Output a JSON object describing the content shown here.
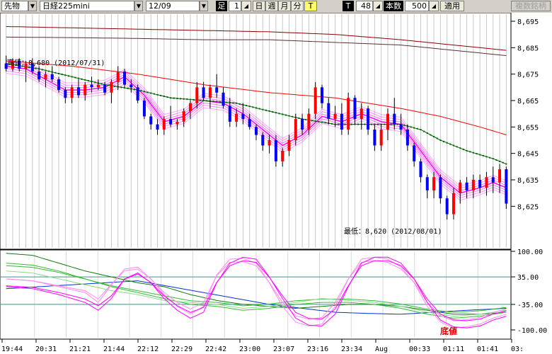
{
  "toolbar": {
    "market_type": "先物",
    "instrument": "日経225mini",
    "contract": "12/09",
    "foot_label": "足",
    "foot_value": "1",
    "period_day": "日",
    "period_week": "週",
    "period_month": "月",
    "period_year": "分",
    "t_label": "T",
    "t_dark_label": "T",
    "t_value": "48",
    "count_label": "本数",
    "count_value": "500",
    "apply_label": "適用",
    "multi_label": "複数銘柄"
  },
  "colors": {
    "up_candle": "#ff0000",
    "down_candle": "#0000ff",
    "ma_dark_red": "#8b0000",
    "ma_red": "#ff0000",
    "ma_brown": "#5a3030",
    "ma_green": "#006400",
    "ribbon": "#ff00ff",
    "oscillator_blue": "#0033cc",
    "oscillator_green": "#00aa00",
    "oscillator_magenta": "#ff00ff",
    "reference_line": "#2e9a8f"
  },
  "chart_data": {
    "type": "candlestick",
    "price_axis": {
      "min": 8620,
      "max": 8695,
      "ticks": [
        "8,695",
        "8,685",
        "8,675",
        "8,665",
        "8,655",
        "8,645",
        "8,635",
        "8,625"
      ]
    },
    "oscillator_axis": {
      "min": -100,
      "max": 100,
      "ticks": [
        "100.00",
        "35.00",
        "-35.00",
        "-100.00"
      ]
    },
    "time_labels": [
      "19:44",
      "20:31",
      "21:21",
      "21:44",
      "22:12",
      "22:29",
      "22:42",
      "23:00",
      "23:07",
      "23:16",
      "23:34",
      "Aug",
      "00:33",
      "01:11",
      "01:41",
      "03:"
    ],
    "candles": [
      [
        8679,
        8682,
        8676,
        8677
      ],
      [
        8677,
        8681,
        8676,
        8680
      ],
      [
        8680,
        8681,
        8676,
        8677
      ],
      [
        8677,
        8680,
        8672,
        8679
      ],
      [
        8679,
        8681,
        8675,
        8676
      ],
      [
        8676,
        8678,
        8672,
        8673
      ],
      [
        8673,
        8676,
        8670,
        8675
      ],
      [
        8675,
        8678,
        8672,
        8673
      ],
      [
        8673,
        8674,
        8668,
        8669
      ],
      [
        8669,
        8670,
        8664,
        8666
      ],
      [
        8666,
        8671,
        8664,
        8670
      ],
      [
        8670,
        8673,
        8666,
        8667
      ],
      [
        8667,
        8672,
        8665,
        8671
      ],
      [
        8671,
        8674,
        8668,
        8670
      ],
      [
        8670,
        8673,
        8669,
        8671
      ],
      [
        8671,
        8672,
        8667,
        8668
      ],
      [
        8668,
        8673,
        8664,
        8672
      ],
      [
        8672,
        8678,
        8669,
        8676
      ],
      [
        8676,
        8677,
        8670,
        8671
      ],
      [
        8671,
        8673,
        8668,
        8670
      ],
      [
        8670,
        8671,
        8664,
        8665
      ],
      [
        8665,
        8666,
        8658,
        8659
      ],
      [
        8659,
        8660,
        8654,
        8656
      ],
      [
        8656,
        8658,
        8652,
        8654
      ],
      [
        8654,
        8659,
        8652,
        8658
      ],
      [
        8658,
        8663,
        8655,
        8656
      ],
      [
        8656,
        8658,
        8654,
        8657
      ],
      [
        8657,
        8662,
        8655,
        8661
      ],
      [
        8661,
        8665,
        8658,
        8664
      ],
      [
        8664,
        8672,
        8662,
        8670
      ],
      [
        8670,
        8672,
        8665,
        8666
      ],
      [
        8666,
        8671,
        8662,
        8670
      ],
      [
        8670,
        8675,
        8666,
        8668
      ],
      [
        8668,
        8670,
        8662,
        8663
      ],
      [
        8663,
        8666,
        8655,
        8657
      ],
      [
        8657,
        8662,
        8655,
        8660
      ],
      [
        8660,
        8664,
        8656,
        8658
      ],
      [
        8658,
        8660,
        8654,
        8655
      ],
      [
        8655,
        8656,
        8650,
        8652
      ],
      [
        8652,
        8653,
        8646,
        8648
      ],
      [
        8648,
        8652,
        8645,
        8650
      ],
      [
        8650,
        8652,
        8640,
        8642
      ],
      [
        8642,
        8647,
        8640,
        8646
      ],
      [
        8646,
        8652,
        8644,
        8650
      ],
      [
        8650,
        8660,
        8648,
        8658
      ],
      [
        8658,
        8660,
        8652,
        8654
      ],
      [
        8654,
        8662,
        8652,
        8660
      ],
      [
        8660,
        8672,
        8658,
        8670
      ],
      [
        8670,
        8671,
        8662,
        8664
      ],
      [
        8664,
        8666,
        8656,
        8658
      ],
      [
        8658,
        8663,
        8655,
        8660
      ],
      [
        8660,
        8664,
        8652,
        8654
      ],
      [
        8654,
        8668,
        8652,
        8666
      ],
      [
        8666,
        8667,
        8656,
        8658
      ],
      [
        8658,
        8664,
        8654,
        8662
      ],
      [
        8662,
        8663,
        8652,
        8654
      ],
      [
        8654,
        8656,
        8646,
        8648
      ],
      [
        8648,
        8656,
        8646,
        8654
      ],
      [
        8654,
        8662,
        8650,
        8660
      ],
      [
        8660,
        8666,
        8654,
        8656
      ],
      [
        8656,
        8660,
        8652,
        8654
      ],
      [
        8654,
        8656,
        8646,
        8648
      ],
      [
        8648,
        8649,
        8640,
        8642
      ],
      [
        8642,
        8643,
        8634,
        8636
      ],
      [
        8636,
        8637,
        8628,
        8631
      ],
      [
        8631,
        8638,
        8628,
        8636
      ],
      [
        8636,
        8637,
        8626,
        8628
      ],
      [
        8628,
        8629,
        8620,
        8622
      ],
      [
        8622,
        8632,
        8620,
        8630
      ],
      [
        8630,
        8635,
        8626,
        8634
      ],
      [
        8634,
        8636,
        8628,
        8631
      ],
      [
        8631,
        8637,
        8628,
        8635
      ],
      [
        8635,
        8637,
        8630,
        8632
      ],
      [
        8632,
        8638,
        8629,
        8636
      ],
      [
        8636,
        8640,
        8630,
        8634
      ],
      [
        8634,
        8641,
        8630,
        8639
      ],
      [
        8639,
        8640,
        8624,
        8626
      ]
    ],
    "ma_dark_red": [
      [
        0,
        8693
      ],
      [
        10,
        8692.5
      ],
      [
        20,
        8692
      ],
      [
        30,
        8691.5
      ],
      [
        40,
        8691
      ],
      [
        50,
        8690
      ],
      [
        60,
        8688
      ],
      [
        76,
        8684
      ]
    ],
    "ma_brown": [
      [
        0,
        8689
      ],
      [
        10,
        8688.8
      ],
      [
        20,
        8688.5
      ],
      [
        30,
        8688
      ],
      [
        40,
        8688
      ],
      [
        50,
        8687
      ],
      [
        60,
        8686
      ],
      [
        76,
        8682
      ]
    ],
    "ma_red": [
      [
        0,
        8680
      ],
      [
        10,
        8678
      ],
      [
        20,
        8675
      ],
      [
        30,
        8671
      ],
      [
        40,
        8668
      ],
      [
        50,
        8666
      ],
      [
        55,
        8664
      ],
      [
        60,
        8662
      ],
      [
        66,
        8659
      ],
      [
        72,
        8655
      ],
      [
        76,
        8652
      ]
    ],
    "ma_green": [
      [
        0,
        8679
      ],
      [
        5,
        8677
      ],
      [
        10,
        8674
      ],
      [
        15,
        8671
      ],
      [
        20,
        8669
      ],
      [
        25,
        8666
      ],
      [
        30,
        8665
      ],
      [
        35,
        8664
      ],
      [
        40,
        8661
      ],
      [
        45,
        8658
      ],
      [
        50,
        8656
      ],
      [
        55,
        8656
      ],
      [
        60,
        8656
      ],
      [
        63,
        8654
      ],
      [
        66,
        8650
      ],
      [
        70,
        8646
      ],
      [
        74,
        8643
      ],
      [
        76,
        8641
      ]
    ],
    "ribbon_center": [
      [
        0,
        8678
      ],
      [
        3,
        8677
      ],
      [
        6,
        8673
      ],
      [
        9,
        8669
      ],
      [
        12,
        8669
      ],
      [
        15,
        8670
      ],
      [
        18,
        8674
      ],
      [
        21,
        8667
      ],
      [
        24,
        8657
      ],
      [
        27,
        8659
      ],
      [
        30,
        8665
      ],
      [
        33,
        8664
      ],
      [
        36,
        8660
      ],
      [
        39,
        8654
      ],
      [
        42,
        8648
      ],
      [
        45,
        8652
      ],
      [
        48,
        8659
      ],
      [
        51,
        8657
      ],
      [
        54,
        8660
      ],
      [
        57,
        8657
      ],
      [
        60,
        8656
      ],
      [
        63,
        8646
      ],
      [
        66,
        8636
      ],
      [
        69,
        8630
      ],
      [
        72,
        8632
      ],
      [
        74,
        8634
      ],
      [
        76,
        8632
      ]
    ],
    "annotation_high": "高値：8,680 (2012/07/31)",
    "annotation_low": "最低：8,620 (2012/08/01)",
    "bottom_marker": "底値",
    "oscillators": [
      {
        "color": "blue",
        "points": [
          [
            0,
            5
          ],
          [
            5,
            10
          ],
          [
            10,
            15
          ],
          [
            15,
            20
          ],
          [
            20,
            25
          ],
          [
            25,
            10
          ],
          [
            30,
            -5
          ],
          [
            35,
            -20
          ],
          [
            40,
            -35
          ],
          [
            45,
            -45
          ],
          [
            50,
            -55
          ],
          [
            55,
            -58
          ],
          [
            60,
            -60
          ],
          [
            65,
            -55
          ],
          [
            70,
            -50
          ],
          [
            76,
            -45
          ]
        ]
      },
      {
        "color": "dark-green",
        "points": [
          [
            0,
            95
          ],
          [
            4,
            90
          ],
          [
            8,
            70
          ],
          [
            12,
            50
          ],
          [
            16,
            35
          ],
          [
            20,
            20
          ],
          [
            24,
            10
          ],
          [
            28,
            -10
          ],
          [
            32,
            -25
          ],
          [
            36,
            -35
          ],
          [
            40,
            -40
          ],
          [
            44,
            -45
          ],
          [
            48,
            -40
          ],
          [
            52,
            -35
          ],
          [
            56,
            -35
          ],
          [
            60,
            -40
          ],
          [
            64,
            -50
          ],
          [
            68,
            -60
          ],
          [
            72,
            -60
          ],
          [
            76,
            -55
          ]
        ]
      },
      {
        "color": "green",
        "points": [
          [
            0,
            70
          ],
          [
            4,
            65
          ],
          [
            8,
            50
          ],
          [
            12,
            30
          ],
          [
            16,
            10
          ],
          [
            20,
            -5
          ],
          [
            24,
            -20
          ],
          [
            28,
            -35
          ],
          [
            32,
            -40
          ],
          [
            36,
            -50
          ],
          [
            40,
            -45
          ],
          [
            44,
            -35
          ],
          [
            48,
            -30
          ],
          [
            52,
            -30
          ],
          [
            56,
            -35
          ],
          [
            60,
            -45
          ],
          [
            64,
            -60
          ],
          [
            68,
            -70
          ],
          [
            72,
            -65
          ],
          [
            76,
            -55
          ]
        ]
      },
      {
        "color": "light-green",
        "points": [
          [
            0,
            50
          ],
          [
            4,
            45
          ],
          [
            8,
            30
          ],
          [
            12,
            15
          ],
          [
            16,
            0
          ],
          [
            20,
            -10
          ],
          [
            24,
            -25
          ],
          [
            28,
            -30
          ],
          [
            32,
            -35
          ],
          [
            36,
            -45
          ],
          [
            40,
            -40
          ],
          [
            44,
            -30
          ],
          [
            48,
            -20
          ],
          [
            52,
            -25
          ],
          [
            56,
            -30
          ],
          [
            60,
            -40
          ],
          [
            64,
            -55
          ],
          [
            68,
            -65
          ],
          [
            72,
            -60
          ],
          [
            76,
            -50
          ]
        ]
      },
      {
        "color": "pink",
        "points": [
          [
            0,
            30
          ],
          [
            4,
            25
          ],
          [
            8,
            10
          ],
          [
            12,
            -5
          ],
          [
            14,
            -30
          ],
          [
            16,
            15
          ],
          [
            18,
            55
          ],
          [
            20,
            60
          ],
          [
            22,
            30
          ],
          [
            24,
            -10
          ],
          [
            26,
            -40
          ],
          [
            28,
            -60
          ],
          [
            30,
            -40
          ],
          [
            32,
            40
          ],
          [
            34,
            80
          ],
          [
            36,
            82
          ],
          [
            38,
            70
          ],
          [
            40,
            20
          ],
          [
            42,
            -40
          ],
          [
            44,
            -80
          ],
          [
            46,
            -90
          ],
          [
            48,
            -85
          ],
          [
            50,
            -40
          ],
          [
            52,
            30
          ],
          [
            54,
            80
          ],
          [
            56,
            85
          ],
          [
            58,
            80
          ],
          [
            60,
            60
          ],
          [
            62,
            20
          ],
          [
            64,
            -40
          ],
          [
            66,
            -80
          ],
          [
            68,
            -95
          ],
          [
            70,
            -92
          ],
          [
            72,
            -85
          ],
          [
            74,
            -70
          ],
          [
            76,
            -60
          ]
        ]
      },
      {
        "color": "magenta",
        "points": [
          [
            0,
            10
          ],
          [
            4,
            5
          ],
          [
            8,
            -10
          ],
          [
            12,
            -30
          ],
          [
            14,
            -50
          ],
          [
            16,
            -20
          ],
          [
            18,
            30
          ],
          [
            20,
            45
          ],
          [
            22,
            20
          ],
          [
            24,
            -20
          ],
          [
            26,
            -50
          ],
          [
            28,
            -70
          ],
          [
            30,
            -55
          ],
          [
            32,
            20
          ],
          [
            34,
            70
          ],
          [
            36,
            85
          ],
          [
            38,
            80
          ],
          [
            40,
            35
          ],
          [
            42,
            -20
          ],
          [
            44,
            -70
          ],
          [
            46,
            -88
          ],
          [
            48,
            -90
          ],
          [
            50,
            -60
          ],
          [
            52,
            10
          ],
          [
            54,
            70
          ],
          [
            56,
            85
          ],
          [
            58,
            85
          ],
          [
            60,
            70
          ],
          [
            62,
            30
          ],
          [
            64,
            -30
          ],
          [
            66,
            -75
          ],
          [
            68,
            -92
          ],
          [
            70,
            -95
          ],
          [
            72,
            -90
          ],
          [
            74,
            -75
          ],
          [
            76,
            -65
          ]
        ]
      }
    ]
  }
}
